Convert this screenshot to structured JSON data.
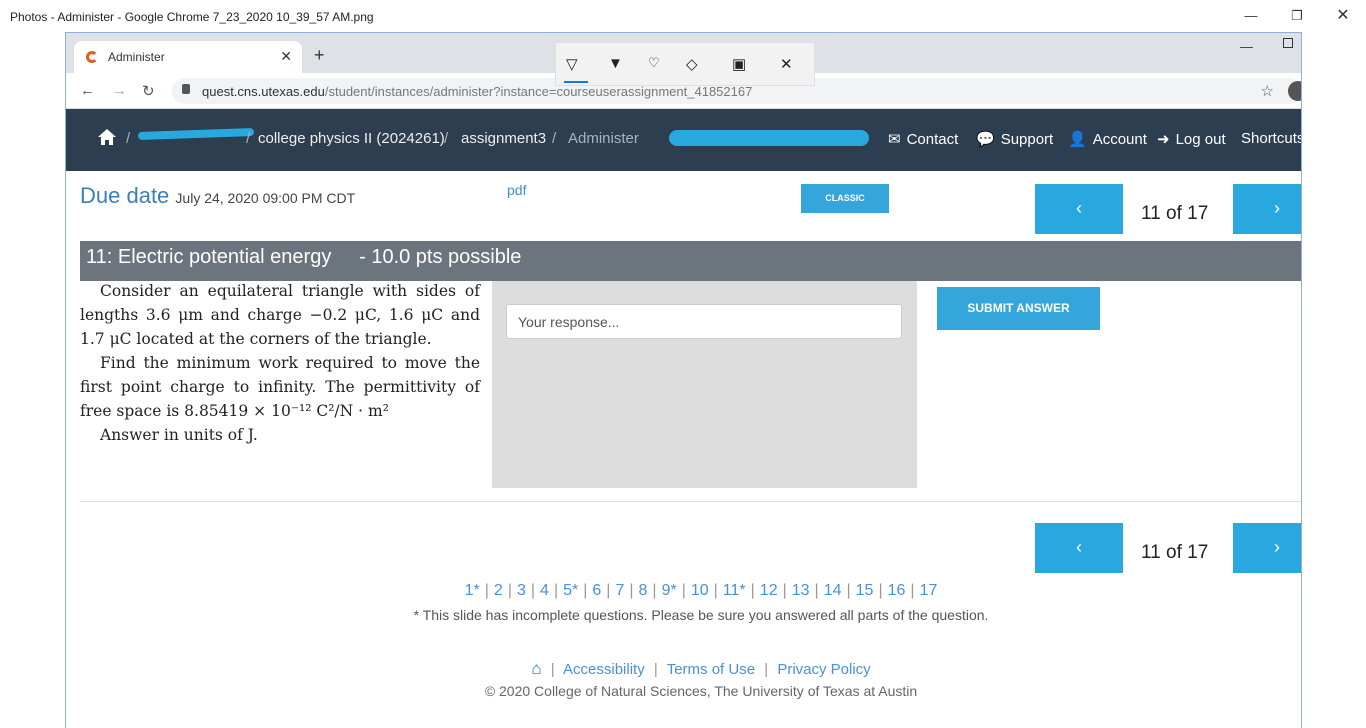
{
  "photos": {
    "title": "Photos - Administer - Google Chrome 7_23_2020 10_39_57 AM.png"
  },
  "browser": {
    "tab_title": "Administer",
    "url_host": "quest.cns.utexas.edu",
    "url_path": "/student/instances/administer?instance=courseuserassignment_41852167"
  },
  "nav": {
    "breadcrumb": [
      "college physics II  (2024261)",
      "assignment3",
      "Administer"
    ],
    "links": [
      "Contact",
      "Support",
      "Account",
      "Log out",
      "Shortcuts"
    ],
    "colors": {
      "bar": "#2c3e50",
      "accent": "#29a8e0"
    }
  },
  "page": {
    "due_label": "Due date",
    "due_value": "July 24, 2020 09:00 PM CDT",
    "pdf_link": "pdf",
    "classic_button": "CLASSIC",
    "pager_text": "11 of 17",
    "question_header": "11: Electric potential energy     - 10.0 pts possible",
    "question_paragraphs": [
      "Consider an equilateral triangle with sides of lengths 3.6 μm and charge −0.2 μC, 1.6 μC and 1.7 μC located at the corners of the triangle.",
      "Find the minimum work required to move the first point charge to infinity.  The permittivity of free space is 8.85419 × 10⁻¹² C²/N · m²",
      "Answer in units of  J."
    ],
    "response_placeholder": "Your response...",
    "submit_label": "SUBMIT ANSWER",
    "question_numbers": [
      "1*",
      "2",
      "3",
      "4",
      "5*",
      "6",
      "7",
      "8",
      "9*",
      "10",
      "11*",
      "12",
      "13",
      "14",
      "15",
      "16",
      "17"
    ],
    "incomplete_note": "* This slide has incomplete questions. Please be sure you answered all parts of the question.",
    "footer_links": [
      "Accessibility",
      "Terms of Use",
      "Privacy Policy"
    ],
    "copyright": "© 2020 College of Natural Sciences, The University of Texas at Austin"
  }
}
